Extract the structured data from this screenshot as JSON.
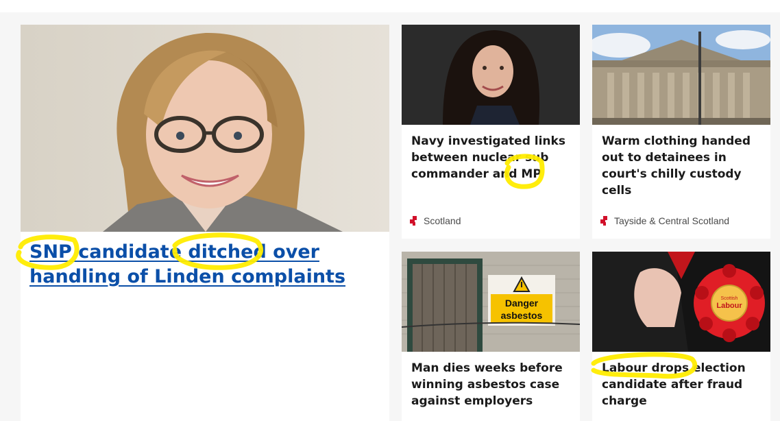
{
  "hero": {
    "headline": "SNP candidate ditched over handling of Linden complaints",
    "image_alt": "Portrait of smiling woman with glasses"
  },
  "cards": [
    {
      "headline": "Navy investigated links between nuclear sub commander and MP",
      "tag": "Scotland",
      "image_alt": "Portrait of woman with dark hair"
    },
    {
      "headline": "Warm clothing handed out to detainees in court's chilly custody cells",
      "tag": "Tayside & Central Scotland",
      "image_alt": "Columned court building facade"
    },
    {
      "headline": "Man dies weeks before winning asbestos case against employers",
      "image_alt": "Wooden door beside danger asbestos sign"
    },
    {
      "headline": "Labour drops election candidate after fraud charge",
      "image_alt": "Red Scottish Labour rosette"
    }
  ],
  "asbestos_sign": {
    "line1": "Danger",
    "line2": "asbestos"
  },
  "rosette": {
    "line1": "Scottish",
    "line2": "Labour"
  },
  "colors": {
    "link_blue": "#0b4fa8",
    "highlighter": "#ffec00",
    "tag_red": "#d1102a"
  }
}
